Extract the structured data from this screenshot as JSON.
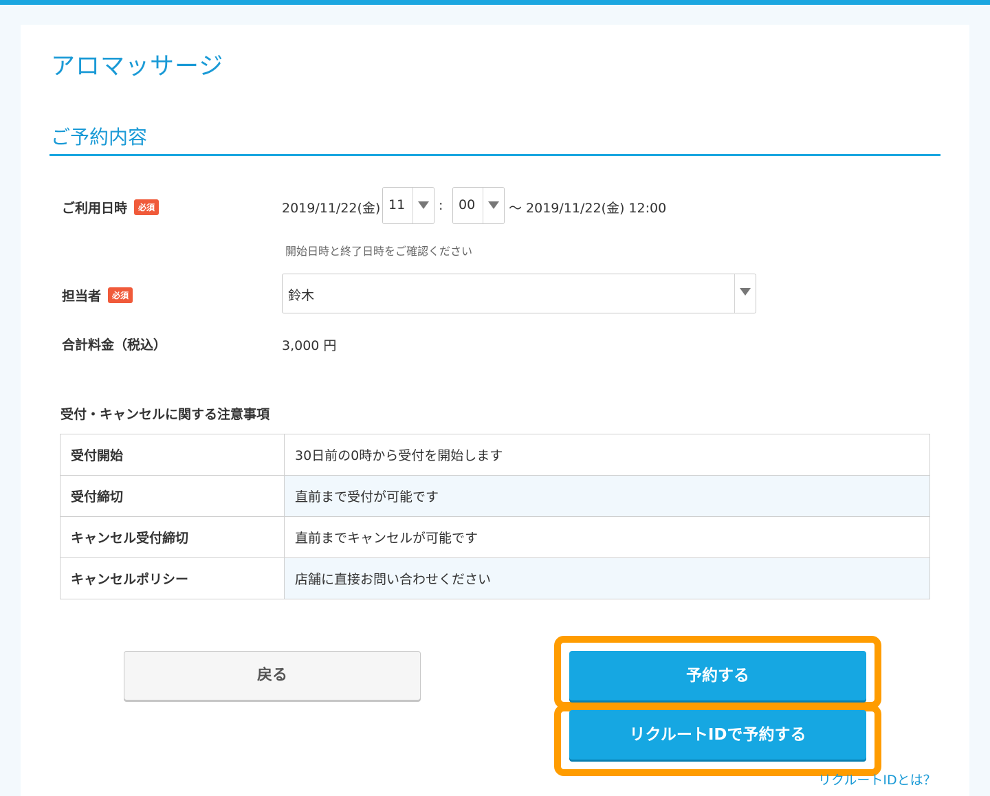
{
  "page": {
    "title": "アロマッサージ"
  },
  "section": {
    "title": "ご予約内容"
  },
  "datetime": {
    "label": "ご利用日時",
    "required_badge": "必須",
    "start_date": "2019/11/22(金)",
    "hour": "11",
    "separator": ":",
    "minute": "00",
    "end_text": "〜 2019/11/22(金) 12:00",
    "hint": "開始日時と終了日時をご確認ください"
  },
  "staff": {
    "label": "担当者",
    "required_badge": "必須",
    "selected": "鈴木"
  },
  "price": {
    "label": "合計料金（税込）",
    "value": "3,000 円"
  },
  "notice": {
    "title": "受付・キャンセルに関する注意事項",
    "rows": [
      {
        "key": "受付開始",
        "value": "30日前の0時から受付を開始します"
      },
      {
        "key": "受付締切",
        "value": "直前まで受付が可能です"
      },
      {
        "key": "キャンセル受付締切",
        "value": "直前までキャンセルが可能です"
      },
      {
        "key": "キャンセルポリシー",
        "value": "店舗に直接お問い合わせください"
      }
    ]
  },
  "buttons": {
    "back": "戻る",
    "reserve": "予約する",
    "reserve_recruit": "リクルートIDで予約する",
    "help_link": "リクルートIDとは？"
  },
  "colors": {
    "accent": "#1aa6e0",
    "highlight": "#ff9c00",
    "badge": "#f05a3a"
  }
}
